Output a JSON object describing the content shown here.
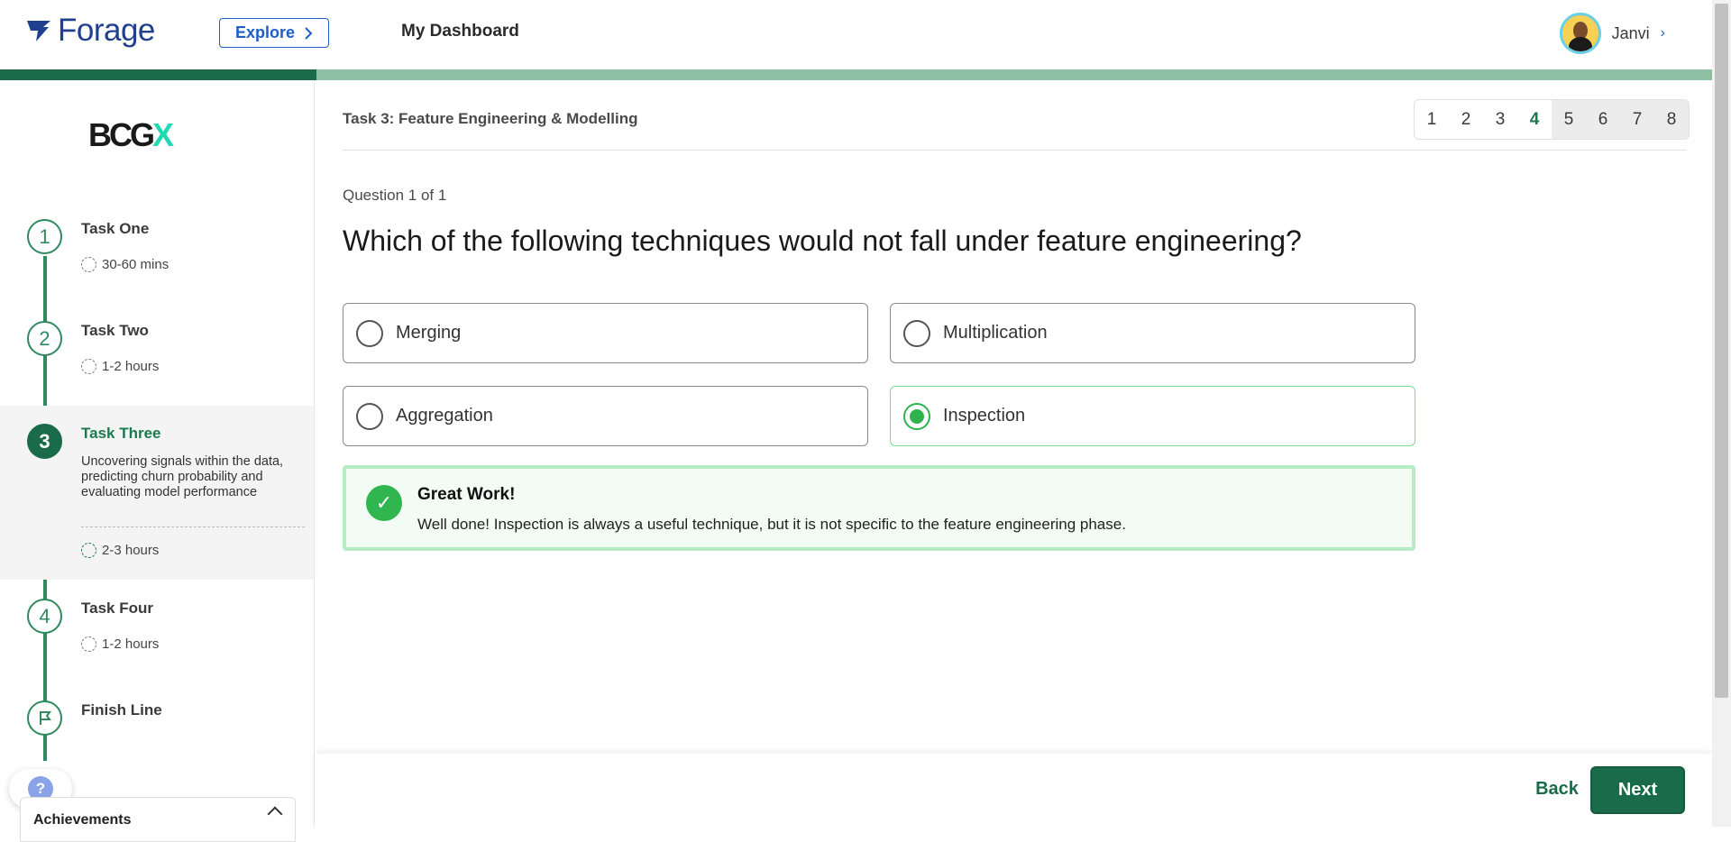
{
  "header": {
    "logo_text": "Forage",
    "explore_label": "Explore",
    "dashboard_label": "My Dashboard",
    "user_name": "Janvi"
  },
  "progress": {
    "fraction": 0.185
  },
  "sidebar": {
    "brand": "BCG",
    "brand_x": "X",
    "tasks": [
      {
        "number": "1",
        "title": "Task One",
        "time": "30-60 mins"
      },
      {
        "number": "2",
        "title": "Task Two",
        "time": "1-2 hours"
      },
      {
        "number": "3",
        "title": "Task Three",
        "description": "Uncovering signals within the data, predicting churn probability and evaluating model performance",
        "time": "2-3 hours"
      },
      {
        "number": "4",
        "title": "Task Four",
        "time": "1-2 hours"
      },
      {
        "title": "Finish Line"
      }
    ],
    "help_label": "?",
    "achievements_label": "Achievements"
  },
  "main": {
    "task_header": "Task 3: Feature Engineering & Modelling",
    "pager": [
      "1",
      "2",
      "3",
      "4",
      "5",
      "6",
      "7",
      "8"
    ],
    "question_count": "Question 1 of 1",
    "question": "Which of the following techniques would not fall under feature engineering?",
    "options": [
      "Merging",
      "Multiplication",
      "Aggregation",
      "Inspection"
    ],
    "selected_option": "Inspection",
    "feedback": {
      "title": "Great Work!",
      "body": "Well done! Inspection is always a useful technique, but it is not specific to the feature engineering phase."
    }
  },
  "footer": {
    "back_label": "Back",
    "next_label": "Next"
  },
  "colors": {
    "brand_green": "#1a6b4a",
    "success_green": "#31b54f",
    "link_blue": "#1f5dc7"
  }
}
